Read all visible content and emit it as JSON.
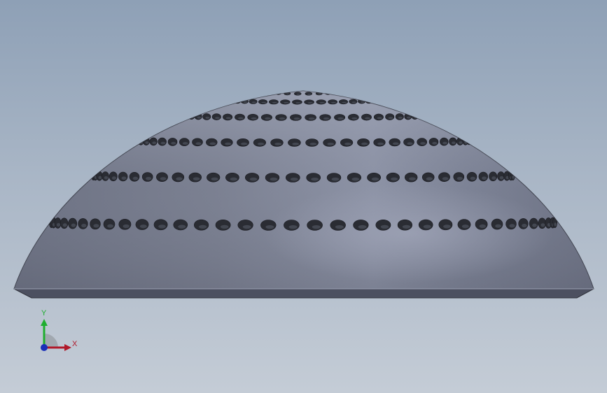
{
  "model": {
    "shape": "perforated hemisphere dome",
    "colors": {
      "background_top": "#8ea0b6",
      "background_bottom": "#c4ccd6",
      "surface_light": "#9aa1b3",
      "surface_dark": "#5e6373",
      "hole": "#2a2c33",
      "base_edge": "#4a4e5b"
    },
    "hole_rows": 6
  },
  "triad": {
    "y_label": "Y",
    "x_label": "X",
    "y_color": "#1fae2f",
    "x_color": "#b0192a",
    "z_color": "#1a2fb8"
  }
}
